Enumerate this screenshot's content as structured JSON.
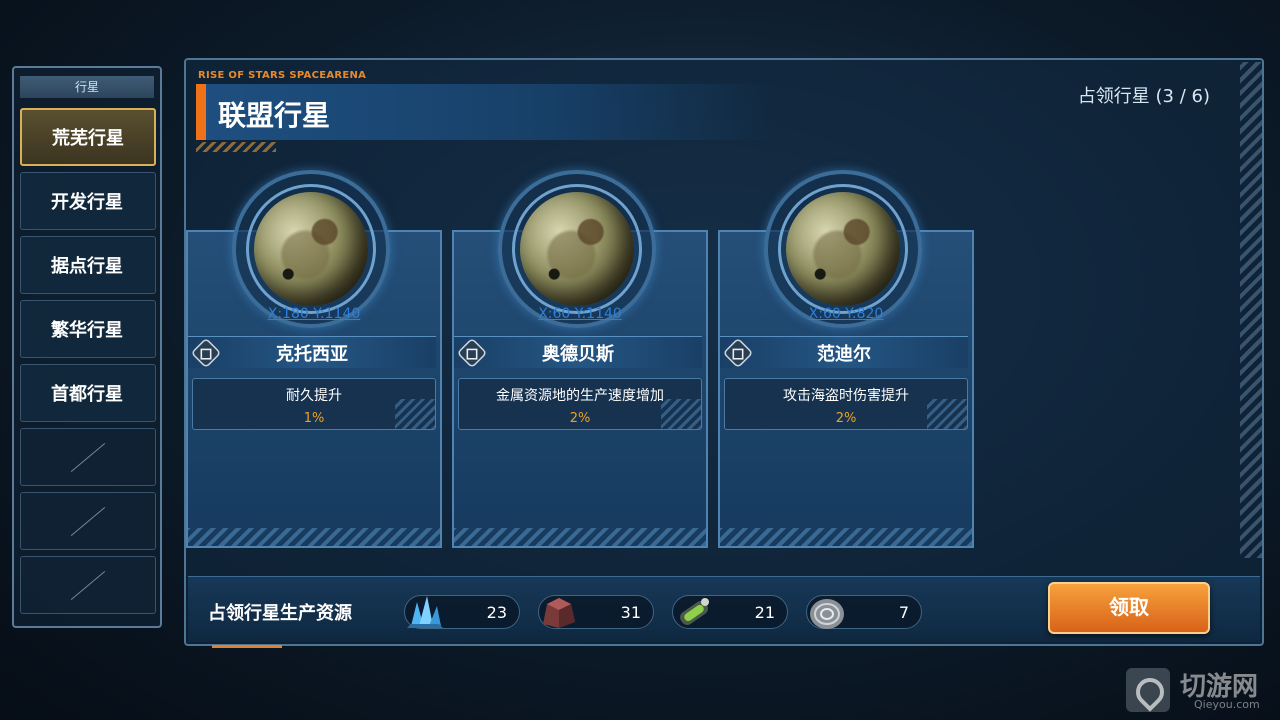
{
  "sidebar": {
    "header": "行星",
    "items": [
      {
        "label": "荒芜行星",
        "active": true
      },
      {
        "label": "开发行星",
        "active": false
      },
      {
        "label": "据点行星",
        "active": false
      },
      {
        "label": "繁华行星",
        "active": false
      },
      {
        "label": "首都行星",
        "active": false
      }
    ],
    "empty_slots": 3
  },
  "panel": {
    "brand": "RISE OF STARS SPACEARENA",
    "title": "联盟行星",
    "occupied": "占领行星 (3 / 6)"
  },
  "planets": [
    {
      "coord": "X:180 Y:1140",
      "name": "克托西亚",
      "effect": "耐久提升",
      "percent": "1%"
    },
    {
      "coord": "X:60 Y:1140",
      "name": "奥德贝斯",
      "effect": "金属资源地的生产速度增加",
      "percent": "2%"
    },
    {
      "coord": "X:60 Y:820",
      "name": "范迪尔",
      "effect": "攻击海盗时伤害提升",
      "percent": "2%"
    }
  ],
  "resources": {
    "label": "占领行星生产资源",
    "items": [
      {
        "icon": "crystal-icon",
        "value": "23"
      },
      {
        "icon": "metal-ore-icon",
        "value": "31"
      },
      {
        "icon": "gas-canister-icon",
        "value": "21"
      },
      {
        "icon": "alloy-disc-icon",
        "value": "7"
      }
    ]
  },
  "claim_button": "领取",
  "watermark": {
    "text": "切游网",
    "sub": "Qieyou.com"
  }
}
